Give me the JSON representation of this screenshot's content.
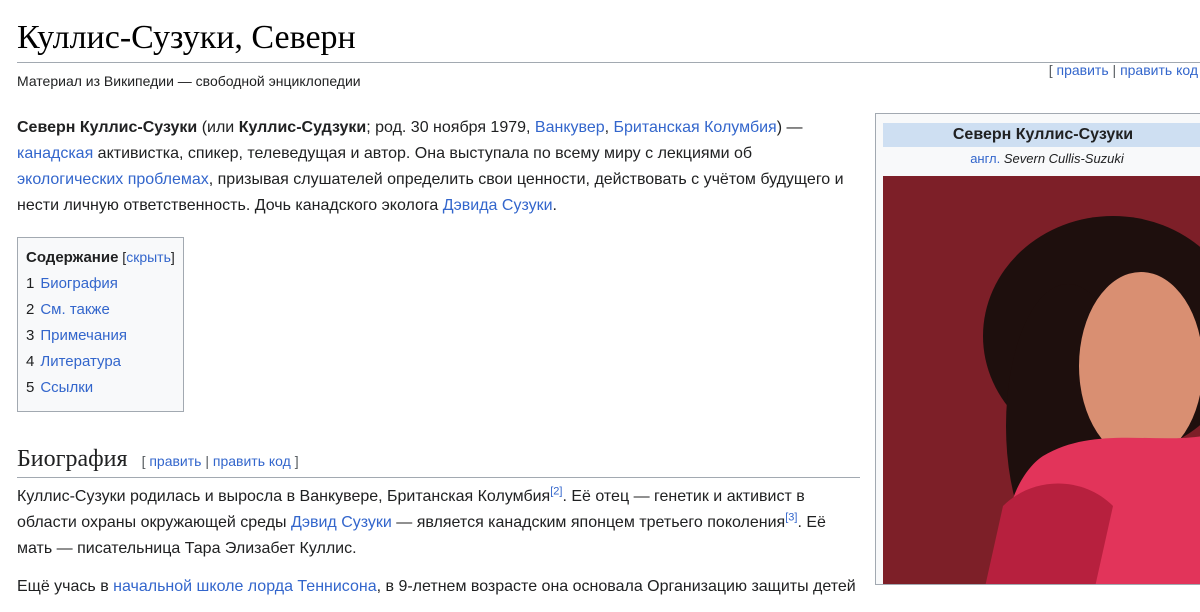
{
  "title": "Куллис-Сузуки, Северн",
  "tagline": "Материал из Википедии — свободной энциклопедии",
  "page_edit": {
    "open": "[ ",
    "edit": "править",
    "sep": " | ",
    "edit_code": "править код"
  },
  "lead": {
    "name_bold": "Северн Куллис-Сузуки",
    "t1": " (или ",
    "alt_name_bold": "Куллис-Судзуки",
    "t2": "; род. 30 ноября 1979, ",
    "link_vancouver": "Ванкувер",
    "t3": ", ",
    "link_bc": "Британская Колумбия",
    "t4": ") — ",
    "link_canadian": "канадская",
    "t5": " активистка, спикер, телеведущая и автор. Она выступала по всему миру с лекциями об ",
    "link_eco": "экологических проблемах",
    "t6": ", призывая слушателей определить свои ценности, действовать с учётом будущего и нести личную ответственность. Дочь канадского эколога ",
    "link_david": "Дэвида Сузуки",
    "t7": "."
  },
  "toc": {
    "heading": "Содержание",
    "hide_open": " [",
    "hide": "скрыть",
    "hide_close": "]",
    "items": [
      {
        "num": "1",
        "label": "Биография"
      },
      {
        "num": "2",
        "label": "См. также"
      },
      {
        "num": "3",
        "label": "Примечания"
      },
      {
        "num": "4",
        "label": "Литература"
      },
      {
        "num": "5",
        "label": "Ссылки"
      }
    ]
  },
  "bio": {
    "heading": "Биография",
    "edit_open": "[ ",
    "edit": "править",
    "sep": " | ",
    "edit_code": "править код",
    "edit_close": " ]",
    "p1_t1": "Куллис-Сузуки родилась и выросла в Ванкувере, Британская Колумбия",
    "ref2": "[2]",
    "p1_t2": ". Её отец — генетик и активист в области охраны окружающей среды ",
    "p1_link_david": "Дэвид Сузуки",
    "p1_t3": " — является канадским японцем третьего поколения",
    "ref3": "[3]",
    "p1_t4": ". Её мать — писательница Тара Элизабет Куллис.",
    "p2_t1": "Ещё учась в ",
    "p2_link_school": "начальной школе лорда Теннисона",
    "p2_t2": ", в 9-летнем возрасте она основала Организацию защиты детей"
  },
  "infobox": {
    "title": "Северн Куллис-Сузуки",
    "sub_lang": "англ.",
    "sub_name": " Severn Cullis-Suzuki",
    "photo_colors": {
      "bg": "#7d1f28",
      "hair": "#1e0f0d",
      "skin": "#d98f72",
      "scarf": "#e2345a"
    }
  }
}
